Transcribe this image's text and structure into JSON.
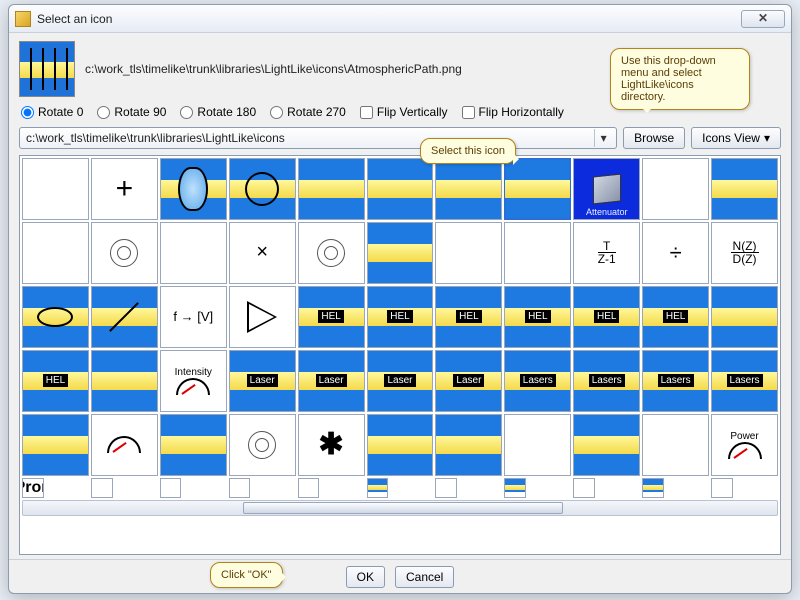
{
  "title": "Select an icon",
  "selected_path": "c:\\work_tls\\timelike\\trunk\\libraries\\LightLike\\icons\\AtmosphericPath.png",
  "rotate": {
    "r0": "Rotate 0",
    "r90": "Rotate 90",
    "r180": "Rotate 180",
    "r270": "Rotate 270",
    "selected": "r0"
  },
  "flip": {
    "vertical": "Flip Vertically",
    "horizontal": "Flip Horizontally"
  },
  "directory": "c:\\work_tls\\timelike\\trunk\\libraries\\LightLike\\icons",
  "browse": "Browse",
  "icons_view": "Icons View",
  "ok": "OK",
  "cancel": "Cancel",
  "callouts": {
    "dropdown": "Use this drop-down menu and select LightLike\\icons directory.",
    "select_icon": "Select this icon",
    "click_ok": "Click \"OK\""
  },
  "icons": [
    [
      {
        "t": "plot",
        "bg": "w"
      },
      {
        "t": "plus",
        "bg": "w"
      },
      {
        "t": "lens",
        "bg": "b"
      },
      {
        "t": "circle",
        "bg": "b"
      },
      {
        "t": "pipe",
        "bg": "b"
      },
      {
        "t": "pipe",
        "bg": "b"
      },
      {
        "t": "pipe",
        "bg": "b"
      },
      {
        "t": "atm",
        "bg": "b",
        "sel": true
      },
      {
        "t": "att",
        "bg": "att",
        "label": "Attenuator"
      },
      {
        "t": "ring",
        "bg": "w"
      },
      {
        "t": "pipe",
        "bg": "b"
      }
    ],
    [
      {
        "t": "grid",
        "bg": "w"
      },
      {
        "t": "target",
        "bg": "w"
      },
      {
        "t": "axes",
        "bg": "w"
      },
      {
        "t": "times",
        "bg": "w"
      },
      {
        "t": "target",
        "bg": "w"
      },
      {
        "t": "pipe",
        "bg": "b"
      },
      {
        "t": "bend",
        "bg": "w"
      },
      {
        "t": "curve",
        "bg": "w"
      },
      {
        "t": "frac",
        "bg": "w",
        "label": "T\nZ-1"
      },
      {
        "t": "divide",
        "bg": "w"
      },
      {
        "t": "frac",
        "bg": "w",
        "label": "N(Z)\nD(Z)"
      }
    ],
    [
      {
        "t": "ellipse",
        "bg": "b"
      },
      {
        "t": "slash",
        "bg": "b"
      },
      {
        "t": "fv",
        "bg": "w",
        "label": "f → [V]"
      },
      {
        "t": "tri",
        "bg": "w"
      },
      {
        "t": "hel",
        "bg": "b",
        "label": "HEL"
      },
      {
        "t": "hel",
        "bg": "b",
        "label": "HEL"
      },
      {
        "t": "hel",
        "bg": "b",
        "label": "HEL"
      },
      {
        "t": "hel",
        "bg": "b",
        "label": "HEL"
      },
      {
        "t": "hel",
        "bg": "b",
        "label": "HEL"
      },
      {
        "t": "hel",
        "bg": "b",
        "label": "HEL"
      },
      {
        "t": "pipe",
        "bg": "b"
      }
    ],
    [
      {
        "t": "hel",
        "bg": "b",
        "label": "HEL"
      },
      {
        "t": "pipe",
        "bg": "b"
      },
      {
        "t": "gauge",
        "bg": "w",
        "label": "Intensity"
      },
      {
        "t": "laser",
        "bg": "b",
        "label": "Laser"
      },
      {
        "t": "laser",
        "bg": "b",
        "label": "Laser"
      },
      {
        "t": "laser",
        "bg": "b",
        "label": "Laser"
      },
      {
        "t": "laser",
        "bg": "b",
        "label": "Laser"
      },
      {
        "t": "laser",
        "bg": "b",
        "label": "Lasers"
      },
      {
        "t": "laser",
        "bg": "b",
        "label": "Lasers"
      },
      {
        "t": "laser",
        "bg": "b",
        "label": "Lasers"
      },
      {
        "t": "laser",
        "bg": "b",
        "label": "Lasers"
      }
    ],
    [
      {
        "t": "grid2",
        "bg": "b"
      },
      {
        "t": "gauge",
        "bg": "w"
      },
      {
        "t": "rocket",
        "bg": "b"
      },
      {
        "t": "target",
        "bg": "w"
      },
      {
        "t": "asterisk",
        "bg": "w"
      },
      {
        "t": "vee",
        "bg": "b"
      },
      {
        "t": "check",
        "bg": "b"
      },
      {
        "t": "sq",
        "bg": "w"
      },
      {
        "t": "pipe",
        "bg": "b"
      },
      {
        "t": "plane",
        "bg": "w"
      },
      {
        "t": "gauge",
        "bg": "w",
        "label": "Power"
      }
    ],
    [
      {
        "t": "prop",
        "bg": "w",
        "label": "Prop",
        "partial": true
      },
      {
        "t": "blank",
        "bg": "w",
        "partial": true
      },
      {
        "t": "wheels",
        "bg": "w",
        "partial": true
      },
      {
        "t": "blank",
        "bg": "w",
        "partial": true
      },
      {
        "t": "arrow",
        "bg": "w",
        "partial": true
      },
      {
        "t": "blank",
        "bg": "b",
        "partial": true
      },
      {
        "t": "blank",
        "bg": "w",
        "partial": true
      },
      {
        "t": "blank",
        "bg": "b",
        "partial": true
      },
      {
        "t": "blank",
        "bg": "w",
        "partial": true
      },
      {
        "t": "blank",
        "bg": "b",
        "partial": true
      },
      {
        "t": "blank",
        "bg": "w",
        "partial": true
      }
    ]
  ]
}
